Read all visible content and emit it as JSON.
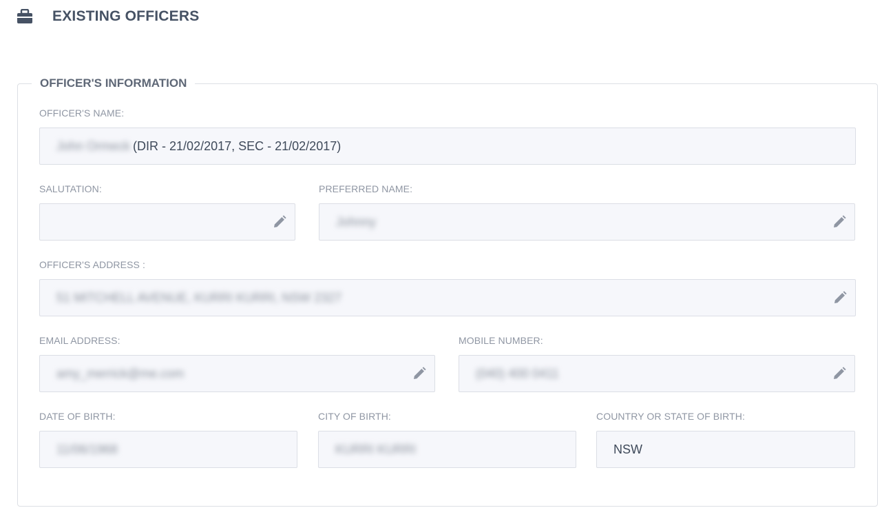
{
  "header": {
    "title": "EXISTING OFFICERS",
    "icon": "briefcase-icon"
  },
  "section": {
    "legend": "OFFICER'S INFORMATION"
  },
  "fields": {
    "officer_name": {
      "label": "OFFICER'S NAME:",
      "name_value": "John Ormeck",
      "roles_value": "(DIR - 21/02/2017, SEC - 21/02/2017)"
    },
    "salutation": {
      "label": "SALUTATION:",
      "value": ""
    },
    "preferred_name": {
      "label": "PREFERRED NAME:",
      "value": "Johnny"
    },
    "address": {
      "label": "OFFICER'S ADDRESS :",
      "value": "51 MITCHELL AVENUE, KURRI KURRI, NSW 2327"
    },
    "email": {
      "label": "EMAIL ADDRESS:",
      "value": "amy_merrick@me.com"
    },
    "mobile": {
      "label": "MOBILE NUMBER:",
      "value": "(040) 400 0411"
    },
    "dob": {
      "label": "DATE OF BIRTH:",
      "value": "11/06/1968"
    },
    "city_of_birth": {
      "label": "CITY OF BIRTH:",
      "value": "KURRI KURRI"
    },
    "country_of_birth": {
      "label": "COUNTRY OR STATE OF BIRTH:",
      "value": "NSW"
    }
  },
  "colors": {
    "title": "#465264",
    "label": "#8f96a3",
    "field_bg": "#f6f7fb",
    "field_border": "#dbdee5",
    "icon": "#8f96a3"
  }
}
